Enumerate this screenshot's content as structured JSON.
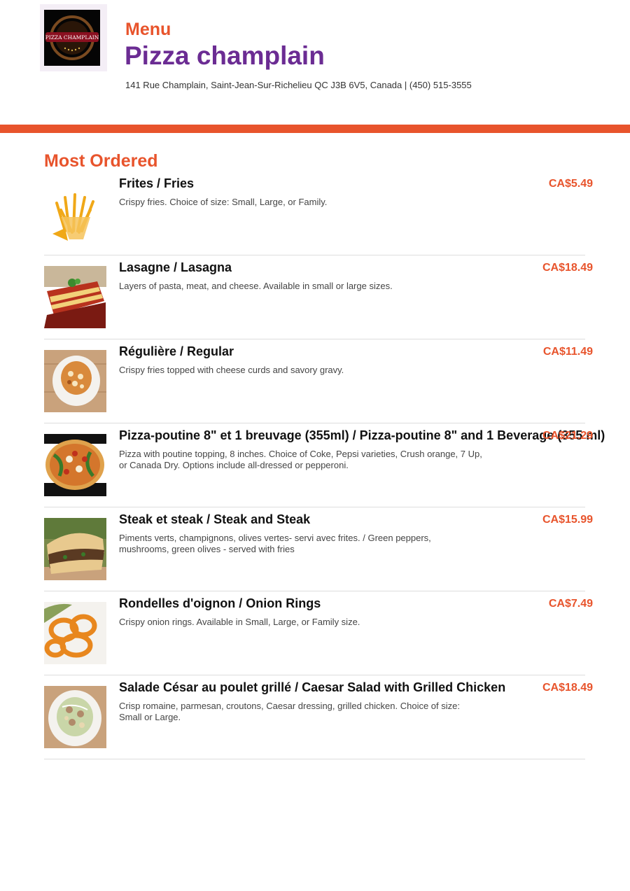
{
  "header": {
    "menu_label": "Menu",
    "restaurant_name": "Pizza champlain",
    "logo_text": "PIZZA CHAMPLAIN",
    "address": "141 Rue Champlain, Saint-Jean-Sur-Richelieu QC J3B 6V5, Canada | (450) 515-3555"
  },
  "colors": {
    "accent": "#e8542c",
    "brand": "#6b2c93"
  },
  "section": {
    "title": "Most Ordered"
  },
  "items": [
    {
      "name": "Frites / Fries",
      "description": "Crispy fries. Choice of size: Small, Large, or Family.",
      "price": "CA$5.49",
      "image_icon": "fries-photo"
    },
    {
      "name": "Lasagne / Lasagna",
      "description": "Layers of pasta, meat, and cheese. Available in small or large sizes.",
      "price": "CA$18.49",
      "image_icon": "lasagna-photo"
    },
    {
      "name": "Régulière / Regular",
      "description": "Crispy fries topped with cheese curds and savory gravy.",
      "price": "CA$11.49",
      "image_icon": "poutine-photo"
    },
    {
      "name": "Pizza-poutine 8\" et 1 breuvage (355ml) / Pizza-poutine 8\" and 1 Beverage (355 ml)",
      "description": "Pizza with poutine topping, 8 inches. Choice of Coke, Pepsi varieties, Crush orange, 7 Up, or Canada Dry. Options include all-dressed or pepperoni.",
      "price": "CA$21.29",
      "image_icon": "pizza-poutine-photo"
    },
    {
      "name": "Steak et steak / Steak and Steak",
      "description": "Piments verts, champignons, olives vertes- servi avec frites. / Green peppers, mushrooms, green olives - served with fries",
      "price": "CA$15.99",
      "image_icon": "steak-sandwich-photo"
    },
    {
      "name": "Rondelles d'oignon / Onion Rings",
      "description": "Crispy onion rings. Available in Small, Large, or Family size.",
      "price": "CA$7.49",
      "image_icon": "onion-rings-photo"
    },
    {
      "name": "Salade César au poulet grillé / Caesar Salad with Grilled Chicken",
      "description": "Crisp romaine, parmesan, croutons, Caesar dressing, grilled chicken. Choice of size: Small or Large.",
      "price": "CA$18.49",
      "image_icon": "caesar-salad-photo"
    }
  ]
}
